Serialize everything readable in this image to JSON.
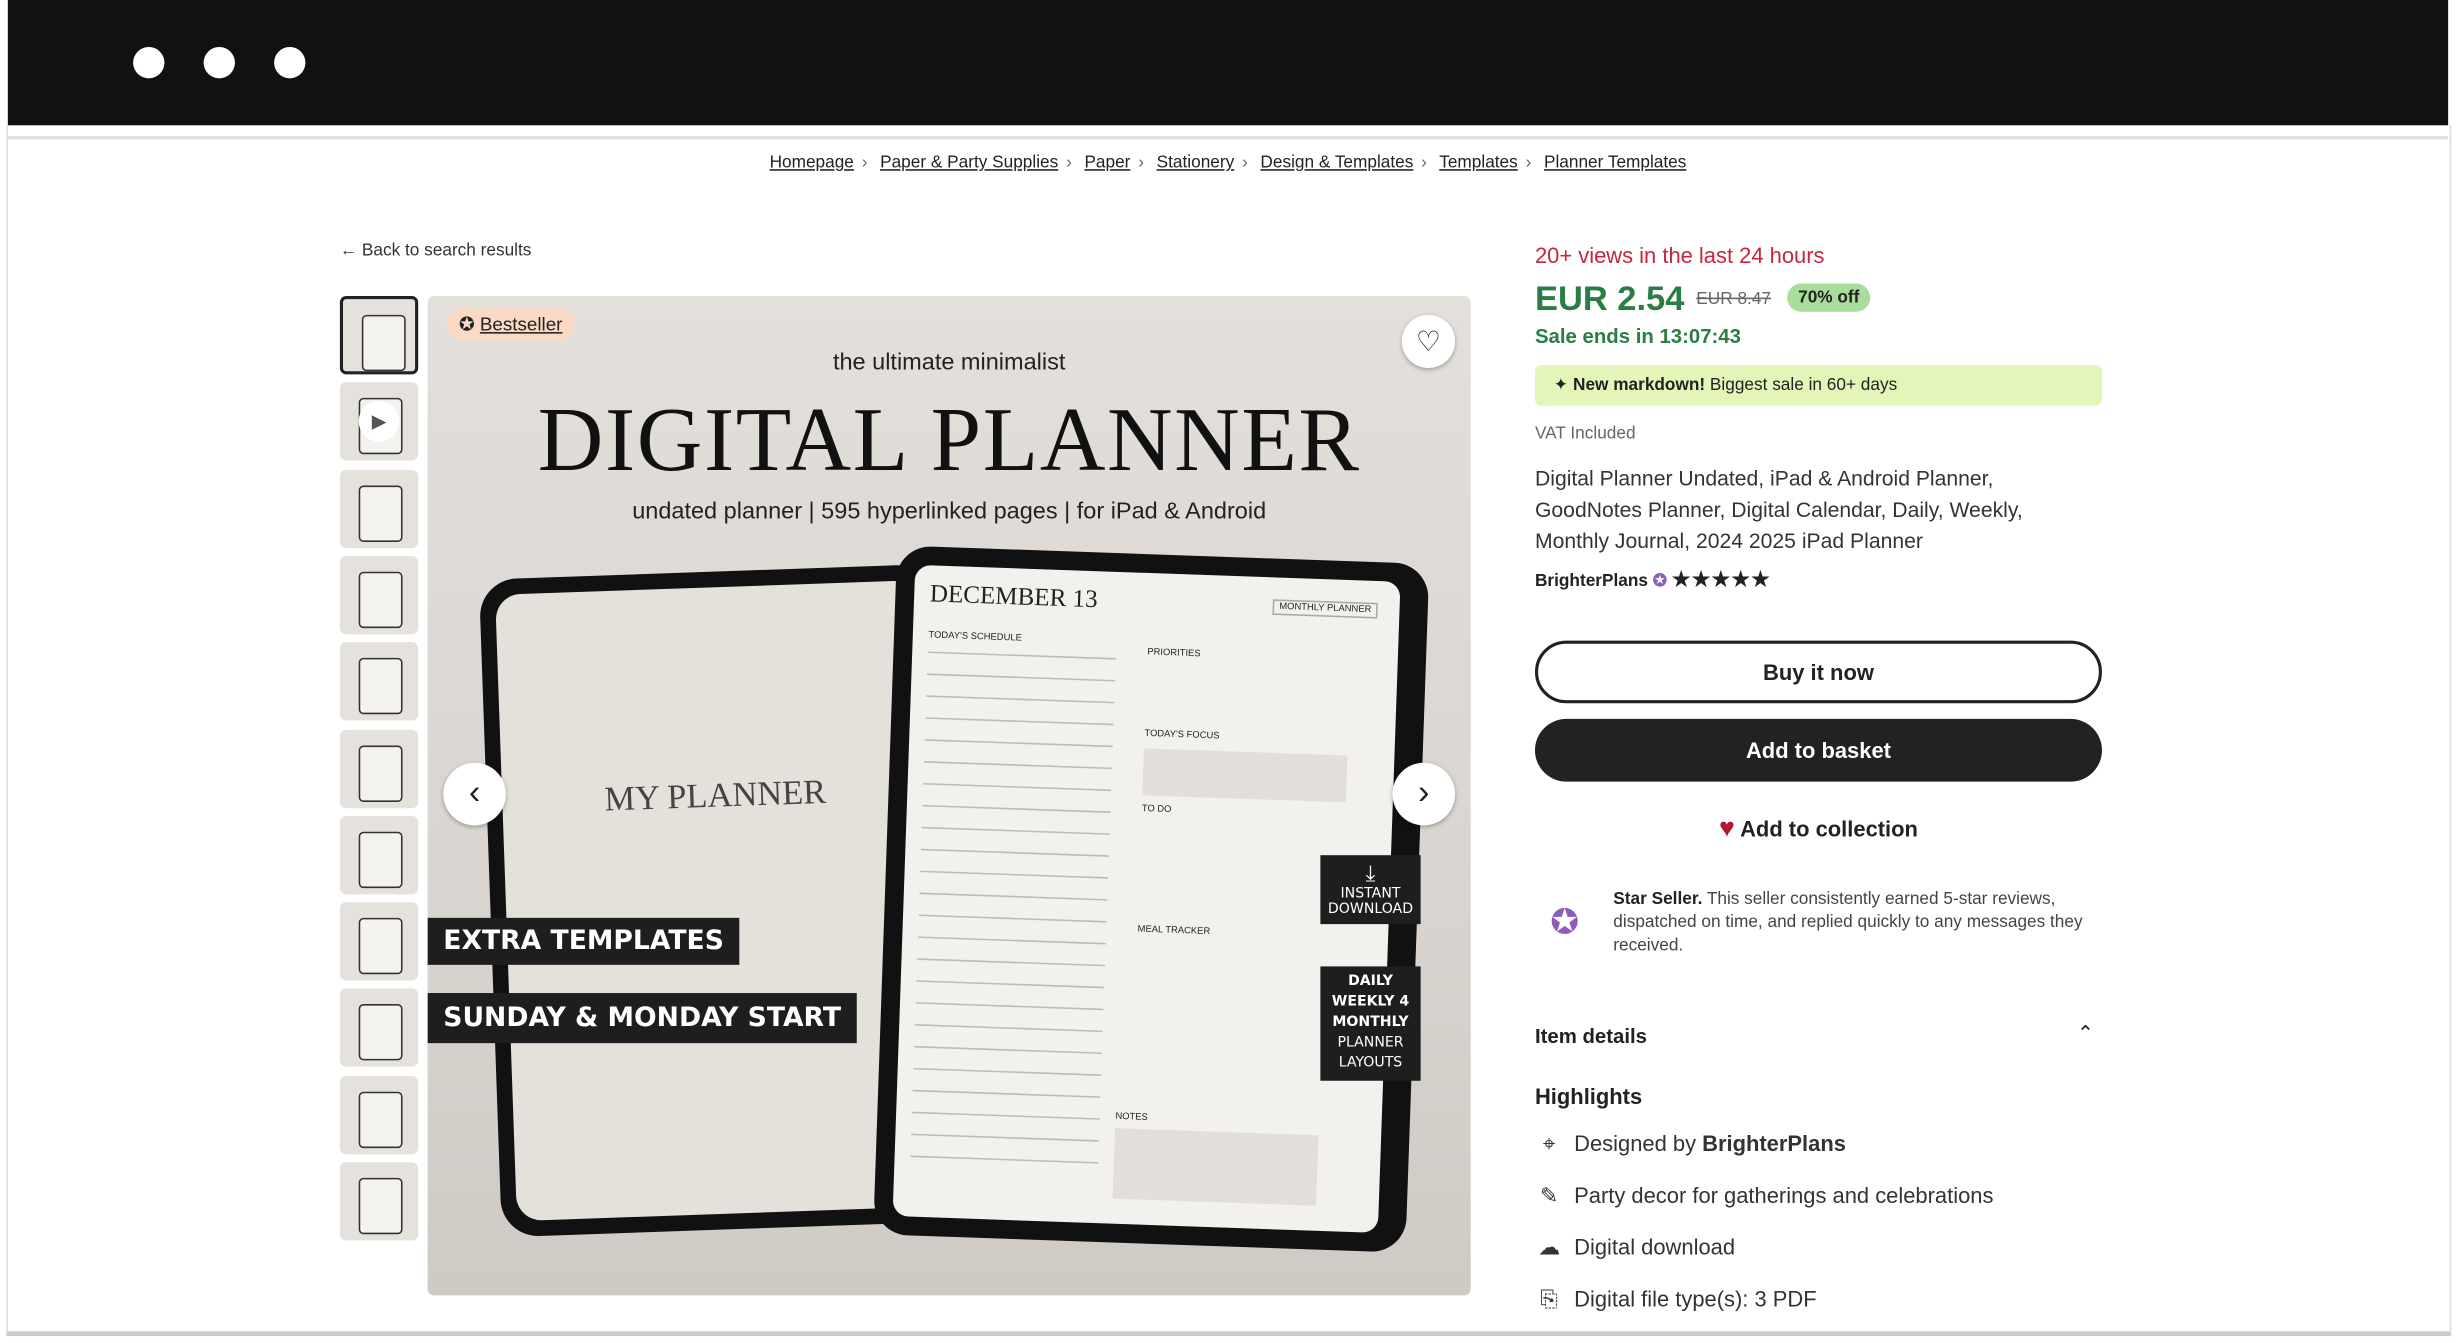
{
  "window": {
    "controls": [
      "close",
      "minimize",
      "maximize"
    ]
  },
  "breadcrumb": [
    "Homepage",
    "Paper & Party Supplies",
    "Paper",
    "Stationery",
    "Design & Templates",
    "Templates",
    "Planner Templates"
  ],
  "back_link": "Back to search results",
  "gallery": {
    "thumbnail_count": 11,
    "badge": "Bestseller",
    "image_text": {
      "kicker": "the ultimate minimalist",
      "title": "DIGITAL PLANNER",
      "subtitle": "undated planner | 595 hyperlinked pages | for iPad & Android",
      "cover": "MY PLANNER",
      "date": "DECEMBER 13",
      "monthly_tab": "MONTHLY PLANNER",
      "schedule": "TODAY'S SCHEDULE",
      "priorities": "PRIORITIES",
      "focus": "TODAY'S FOCUS",
      "todo": "TO DO",
      "meal": "MEAL TRACKER",
      "notes": "NOTES",
      "tag1": "EXTRA TEMPLATES",
      "tag2": "SUNDAY & MONDAY START",
      "tag3": "INSTANT DOWNLOAD",
      "tag4": "DAILY WEEKLY 4 MONTHLY",
      "tag4b": "PLANNER LAYOUTS"
    }
  },
  "product": {
    "views": "20+ views in the last 24 hours",
    "price": "EUR 2.54",
    "original_price": "EUR 8.47",
    "discount": "70% off",
    "sale_ends": "Sale ends in 13:07:43",
    "markdown_bold": "New markdown!",
    "markdown_text": "Biggest sale in 60+ days",
    "vat": "VAT Included",
    "title": "Digital Planner Undated, iPad & Android Planner, GoodNotes Planner, Digital Calendar, Daily, Weekly, Monthly Journal, 2024 2025 iPad Planner",
    "seller": "BrighterPlans",
    "rating": 5,
    "stars": "★★★★★",
    "buy_now": "Buy it now",
    "add_basket": "Add to basket",
    "add_collection": "Add to collection",
    "star_seller_bold": "Star Seller.",
    "star_seller_text": "This seller consistently earned 5-star reviews, dispatched on time, and replied quickly to any messages they received.",
    "item_details": "Item details",
    "highlights_title": "Highlights",
    "highlights": {
      "designed_prefix": "Designed by",
      "designed_by": "BrighterPlans",
      "party": "Party decor for gatherings and celebrations",
      "download": "Digital download",
      "file_types": "Digital file type(s): 3 PDF"
    }
  },
  "colors": {
    "views": "#c8263c",
    "price": "#2a7d43",
    "discount_bg": "#a8dd9c",
    "markdown_bg": "#e3f5b8",
    "star_seller": "#8c5bbf",
    "heart": "#b3172c"
  }
}
